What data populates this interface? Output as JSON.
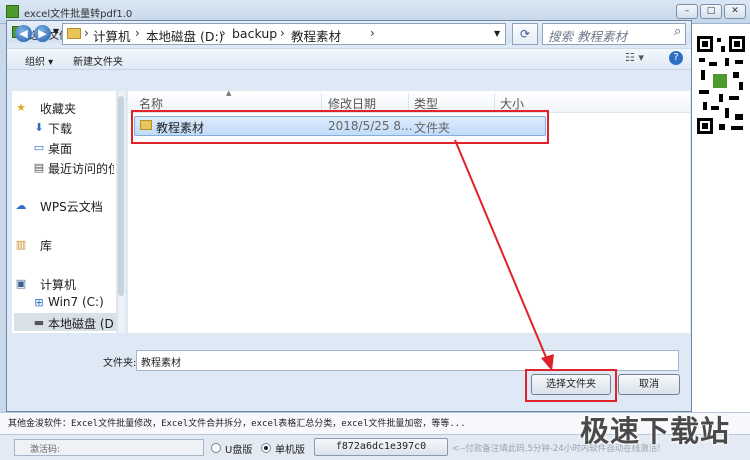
{
  "app": {
    "title": "excel文件批量转pdf1.0",
    "icon": "app-logo-icon"
  },
  "dialog": {
    "title": "选择文件夹",
    "breadcrumb": [
      "计算机",
      "本地磁盘 (D:)",
      "backup",
      "教程素材"
    ],
    "search_placeholder": "搜索 教程素材",
    "toolbar": {
      "organize": "组织 ▾",
      "new_folder": "新建文件夹"
    },
    "sidebar": {
      "favorites": "收藏夹",
      "downloads": "下载",
      "desktop": "桌面",
      "recent": "最近访问的位",
      "wps": "WPS云文档",
      "libraries": "库",
      "computer": "计算机",
      "drive_c": "Win7 (C:)",
      "drive_d": "本地磁盘 (D:"
    },
    "columns": {
      "name": "名称",
      "modified": "修改日期",
      "type": "类型",
      "size": "大小"
    },
    "rows": [
      {
        "name": "教程素材",
        "modified": "2018/5/25 8...",
        "type": "文件夹"
      }
    ],
    "folder_label": "文件夹:",
    "folder_value": "教程素材",
    "select_button": "选择文件夹",
    "cancel_button": "取消"
  },
  "info_text": "其他金浚软件：Excel文件批量修改，Excel文件合并拆分，excel表格汇总分类，excel文件批量加密，等等...",
  "status": {
    "activation_label": "激活码:",
    "radio1": "U盘版",
    "radio2": "单机版",
    "machine_code": "f872a6dc1e397c0",
    "hint": "<--付款备注填此码,5分钟-24小时内软件自动在线激活!"
  },
  "watermark": "极速下载站",
  "colors": {
    "highlight_box": "#e0222a",
    "selection": "#c1dcfa"
  }
}
